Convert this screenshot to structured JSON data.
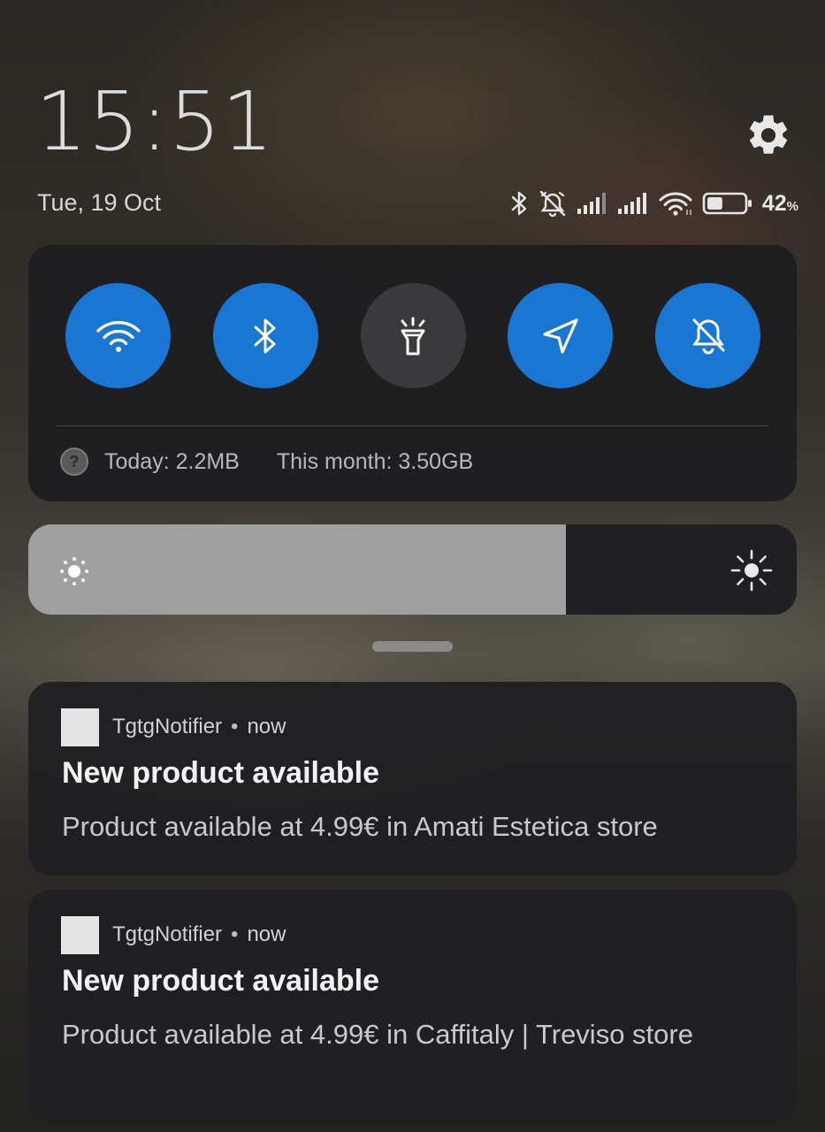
{
  "header": {
    "time": "15:51",
    "date": "Tue, 19 Oct",
    "battery_percent": "42",
    "battery_unit": "%",
    "battery_level": 0.42
  },
  "icons": {
    "settings": "gear-icon",
    "status": [
      "bluetooth-icon",
      "alarm-off-icon",
      "signal-icon",
      "signal-icon",
      "wifi-icon",
      "battery-icon"
    ]
  },
  "quick_settings": {
    "tiles": [
      {
        "id": "wifi",
        "icon": "wifi-icon",
        "active": true
      },
      {
        "id": "bluetooth",
        "icon": "bluetooth-icon",
        "active": true
      },
      {
        "id": "flashlight",
        "icon": "flashlight-icon",
        "active": false
      },
      {
        "id": "location",
        "icon": "location-icon",
        "active": true
      },
      {
        "id": "silent",
        "icon": "bell-off-icon",
        "active": true
      }
    ],
    "help_glyph": "?",
    "usage_today": "Today: 2.2MB",
    "usage_month": "This month: 3.50GB",
    "active_color": "#1976d2",
    "inactive_color": "#3a3a3c"
  },
  "brightness": {
    "level": 0.7
  },
  "notifications": [
    {
      "app": "TgtgNotifier",
      "separator": "•",
      "time": "now",
      "title": "New product available",
      "body": "Product available at 4.99€ in Amati Estetica store"
    },
    {
      "app": "TgtgNotifier",
      "separator": "•",
      "time": "now",
      "title": "New product available",
      "body": "Product available at 4.99€ in Caffitaly | Treviso store"
    }
  ]
}
